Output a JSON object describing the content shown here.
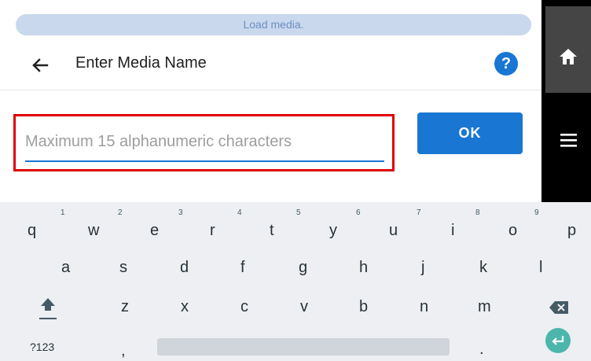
{
  "toast": {
    "text": "Load media."
  },
  "header": {
    "title": "Enter Media Name",
    "help_label": "?"
  },
  "input": {
    "value": "",
    "placeholder": "Maximum 15 alphanumeric characters"
  },
  "ok_button": {
    "label": "OK"
  },
  "colors": {
    "accent": "#1976d2",
    "highlight_border": "#e00000",
    "enter_key": "#4db6ac"
  },
  "keyboard": {
    "row1": [
      "q",
      "w",
      "e",
      "r",
      "t",
      "y",
      "u",
      "i",
      "o",
      "p"
    ],
    "row1_hints": [
      "1",
      "2",
      "3",
      "4",
      "5",
      "6",
      "7",
      "8",
      "9"
    ],
    "row2": [
      "a",
      "s",
      "d",
      "f",
      "g",
      "h",
      "j",
      "k",
      "l"
    ],
    "row3": [
      "z",
      "x",
      "c",
      "v",
      "b",
      "n",
      "m"
    ],
    "symbols_label": "?123",
    "comma": ",",
    "period": "."
  },
  "icons": [
    "back-arrow-icon",
    "help-icon",
    "home-icon",
    "menu-icon",
    "shift-icon",
    "backspace-icon",
    "enter-icon"
  ]
}
